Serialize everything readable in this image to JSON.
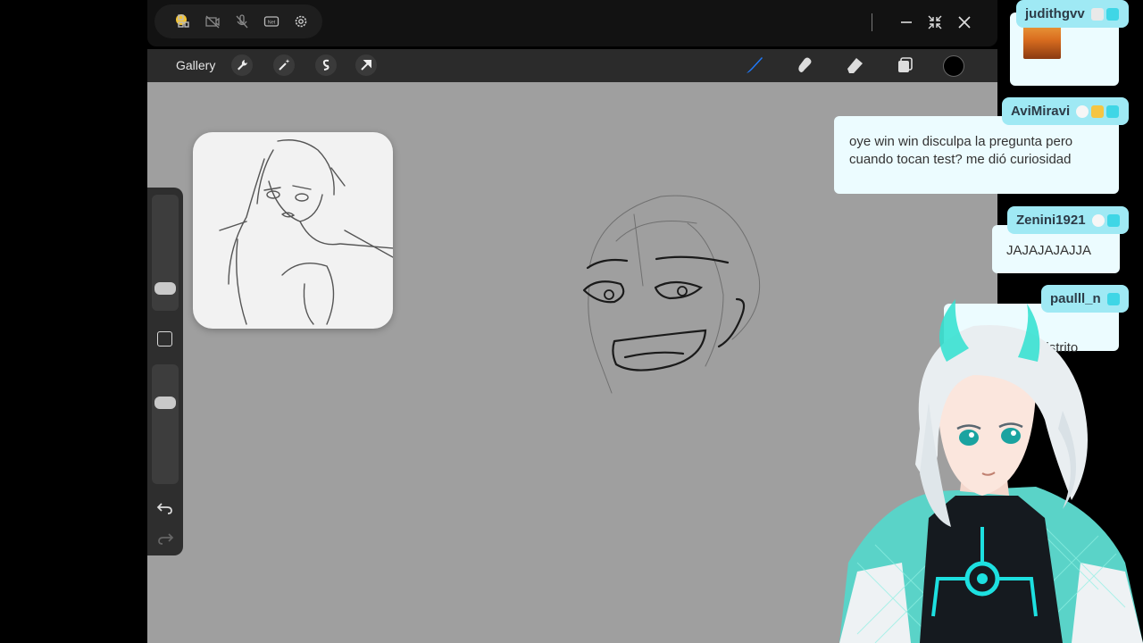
{
  "app": {
    "gallery_label": "Gallery",
    "toolbar_icons": [
      "wrench-icon",
      "magic-wand-icon",
      "selection-s-icon",
      "transform-arrow-icon"
    ],
    "tools": [
      "brush-icon",
      "smudge-icon",
      "eraser-icon",
      "layers-icon"
    ],
    "accent": "#1f7bff",
    "current_color": "#000000"
  },
  "mirror_bar": {
    "icons": [
      "screen-share-icon",
      "camera-off-icon",
      "mic-off-icon",
      "network-icon",
      "settings-icon"
    ],
    "network_label": "Net",
    "window_controls": [
      "minimize-icon",
      "collapse-icon",
      "close-icon"
    ]
  },
  "chat": [
    {
      "user": "judithgvv",
      "badges": [
        "clock-badge",
        "sub-badge"
      ],
      "message": "",
      "emote": "sunset-emote"
    },
    {
      "user": "AviMiravi",
      "badges": [
        "egg-badge",
        "crown-badge",
        "sub-badge"
      ],
      "message": "oye win win disculpa la pregunta pero cuando tocan test? me dió curiosidad"
    },
    {
      "user": "Zenini1921",
      "badges": [
        "egg-badge",
        "sub-badge"
      ],
      "message": "JAJAJAJAJJA"
    },
    {
      "user": "paulll_n",
      "badges": [
        "sub-badge"
      ],
      "message": "ze         os distrito"
    }
  ],
  "colors": {
    "chat_name_bg": "#9fe9f4",
    "chat_msg_bg": "#ecfcff",
    "canvas_bg": "#9f9f9f"
  }
}
